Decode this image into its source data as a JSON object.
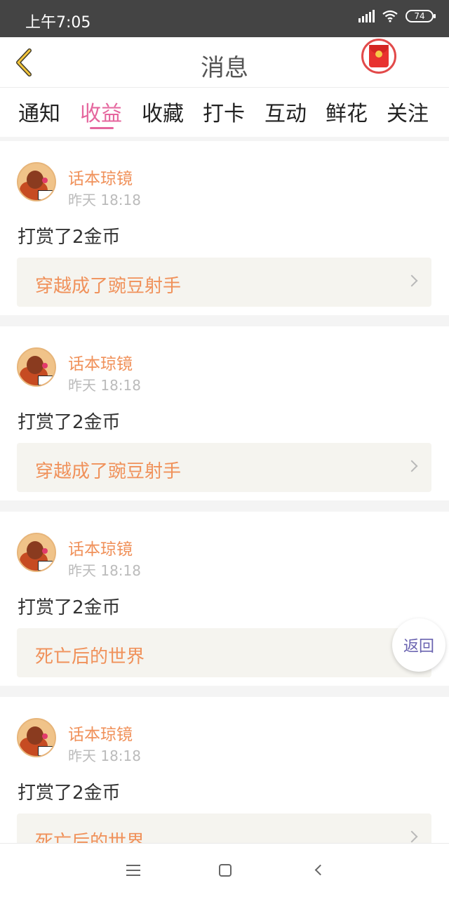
{
  "status_bar": {
    "time": "上午7:05",
    "battery": "74"
  },
  "header": {
    "title": "消息",
    "back_icon": "back-chevron-icon",
    "redpacket_icon": "red-packet-icon"
  },
  "tabs": [
    {
      "label": "通知"
    },
    {
      "label": "收益",
      "active": true
    },
    {
      "label": "收藏"
    },
    {
      "label": "打卡"
    },
    {
      "label": "互动"
    },
    {
      "label": "鲜花"
    },
    {
      "label": "关注"
    }
  ],
  "notifications": [
    {
      "user": "话本琼镜",
      "time": "昨天 18:18",
      "action": "打赏了2金币",
      "book": "穿越成了豌豆射手"
    },
    {
      "user": "话本琼镜",
      "time": "昨天 18:18",
      "action": "打赏了2金币",
      "book": "穿越成了豌豆射手"
    },
    {
      "user": "话本琼镜",
      "time": "昨天 18:18",
      "action": "打赏了2金币",
      "book": "死亡后的世界"
    },
    {
      "user": "话本琼镜",
      "time": "昨天 18:18",
      "action": "打赏了2金币",
      "book": "死亡后的世界"
    }
  ],
  "floating": {
    "return_label": "返回"
  },
  "colors": {
    "accent": "#e5669e",
    "name": "#f0915a",
    "status_bar": "#444444"
  }
}
